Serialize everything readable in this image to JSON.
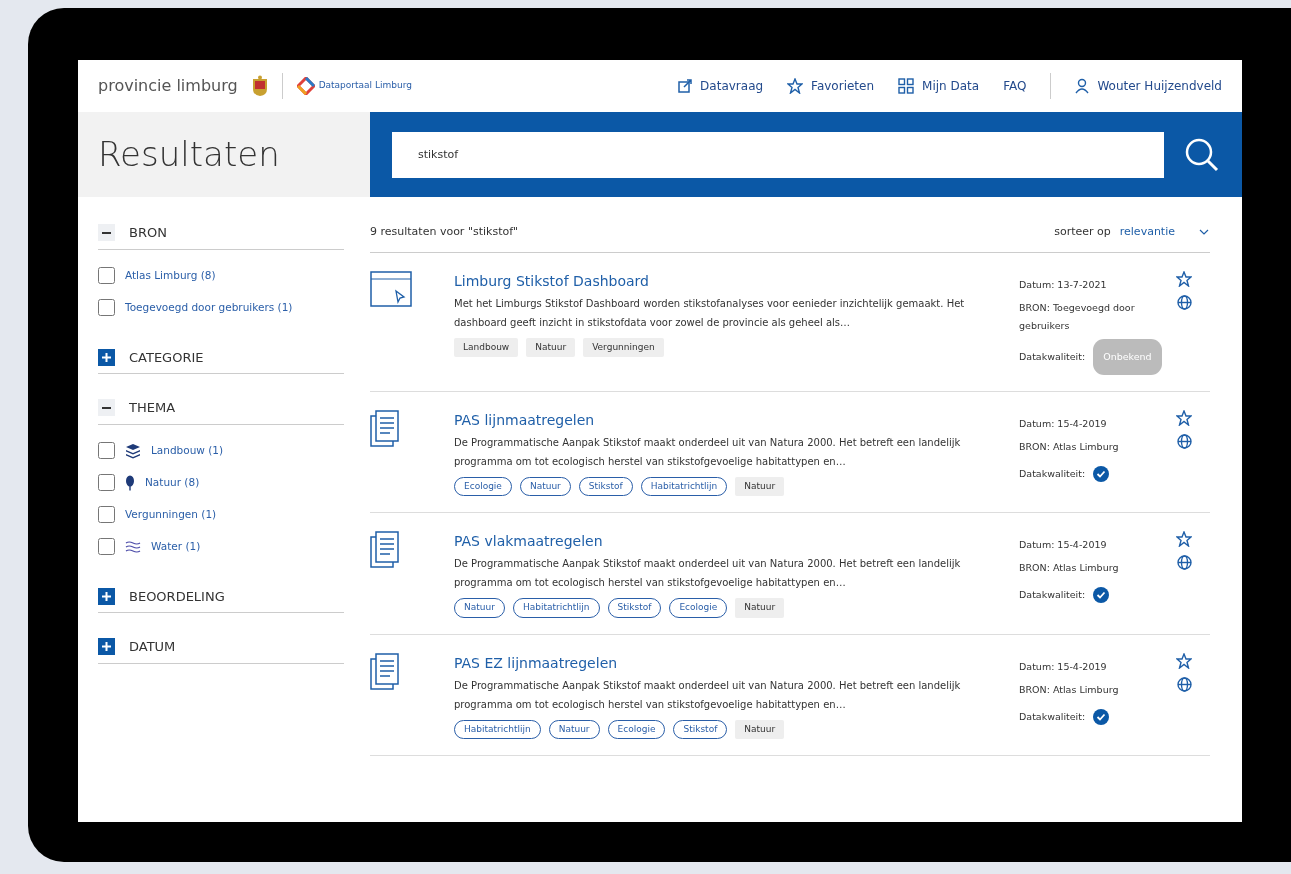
{
  "header": {
    "brand": "provincie limburg",
    "portal": "Dataportaal Limburg",
    "nav": [
      {
        "label": "Datavraag",
        "kind": "external"
      },
      {
        "label": "Favorieten",
        "kind": "star"
      },
      {
        "label": "Mijn Data",
        "kind": "grid"
      },
      {
        "label": "FAQ"
      }
    ],
    "user": "Wouter Huijzendveld"
  },
  "page_title": "Resultaten",
  "search": {
    "value": "stikstof"
  },
  "filters": [
    {
      "title": "BRON",
      "expanded": true,
      "items": [
        {
          "label": "Atlas Limburg (8)",
          "checked": false
        },
        {
          "label": "Toegevoegd door gebruikers (1)",
          "checked": false
        }
      ]
    },
    {
      "title": "CATEGORIE",
      "expanded": false
    },
    {
      "title": "THEMA",
      "expanded": true,
      "items": [
        {
          "label": "Landbouw (1)",
          "checked": false,
          "kind": "layers"
        },
        {
          "label": "Natuur (8)",
          "checked": false,
          "kind": "tree"
        },
        {
          "label": "Vergunningen (1)",
          "checked": false
        },
        {
          "label": "Water (1)",
          "checked": false,
          "kind": "waves"
        }
      ]
    },
    {
      "title": "BEOORDELING",
      "expanded": false
    },
    {
      "title": "DATUM",
      "expanded": false
    }
  ],
  "results_summary": "9 resultaten voor \"stikstof\"",
  "sort": {
    "label": "sorteer op",
    "value": "relevantie"
  },
  "results": [
    {
      "kind": "app",
      "title": "Limburg Stikstof Dashboard",
      "description": "Met het Limburgs Stikstof Dashboard worden stikstofanalyses voor eenieder inzichtelijk gemaakt. Het dashboard geeft inzicht in stikstofdata voor zowel de provincie als geheel als…",
      "tags": [
        {
          "label": "Landbouw",
          "kind": "plain"
        },
        {
          "label": "Natuur",
          "kind": "plain"
        },
        {
          "label": "Vergunningen",
          "kind": "plain"
        }
      ],
      "date": "Datum: 13-7-2021",
      "source": "BRON: Toegevoegd door gebruikers",
      "quality_label": "Datakwaliteit:",
      "quality": {
        "kind": "badge",
        "label": "Onbekend"
      }
    },
    {
      "kind": "document",
      "title": "PAS lijnmaatregelen",
      "description": "De Programmatische Aanpak Stikstof maakt onderdeel uit van Natura 2000. Het betreft een landelijk programma om tot ecologisch herstel van stikstofgevoelige habitattypen en…",
      "tags": [
        {
          "label": "Ecologie",
          "kind": "outline"
        },
        {
          "label": "Natuur",
          "kind": "outline"
        },
        {
          "label": "Stikstof",
          "kind": "outline"
        },
        {
          "label": "Habitatrichtlijn",
          "kind": "outline"
        },
        {
          "label": "Natuur",
          "kind": "plain"
        }
      ],
      "date": "Datum: 15-4-2019",
      "source": "BRON: Atlas Limburg",
      "quality_label": "Datakwaliteit:",
      "quality": {
        "kind": "check"
      }
    },
    {
      "kind": "document",
      "title": "PAS vlakmaatregelen",
      "description": "De Programmatische Aanpak Stikstof maakt onderdeel uit van Natura 2000. Het betreft een landelijk programma om tot ecologisch herstel van stikstofgevoelige habitattypen en…",
      "tags": [
        {
          "label": "Natuur",
          "kind": "outline"
        },
        {
          "label": "Habitatrichtlijn",
          "kind": "outline"
        },
        {
          "label": "Stikstof",
          "kind": "outline"
        },
        {
          "label": "Ecologie",
          "kind": "outline"
        },
        {
          "label": "Natuur",
          "kind": "plain"
        }
      ],
      "date": "Datum: 15-4-2019",
      "source": "BRON: Atlas Limburg",
      "quality_label": "Datakwaliteit:",
      "quality": {
        "kind": "check"
      }
    },
    {
      "kind": "document",
      "title": "PAS EZ lijnmaatregelen",
      "description": "De Programmatische Aanpak Stikstof maakt onderdeel uit van Natura 2000. Het betreft een landelijk programma om tot ecologisch herstel van stikstofgevoelige habitattypen en…",
      "tags": [
        {
          "label": "Habitatrichtlijn",
          "kind": "outline"
        },
        {
          "label": "Natuur",
          "kind": "outline"
        },
        {
          "label": "Ecologie",
          "kind": "outline"
        },
        {
          "label": "Stikstof",
          "kind": "outline"
        },
        {
          "label": "Natuur",
          "kind": "plain"
        }
      ],
      "date": "Datum: 15-4-2019",
      "source": "BRON: Atlas Limburg",
      "quality_label": "Datakwaliteit:",
      "quality": {
        "kind": "check"
      }
    }
  ]
}
